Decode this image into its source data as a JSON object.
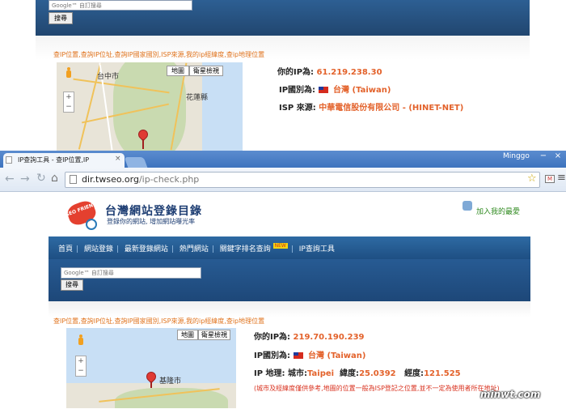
{
  "background_page": {
    "search_placeholder": "Google™ 自訂搜尋",
    "search_button": "搜尋",
    "links_line": "查IP位置,查詢IP位址,查詢IP國家國別,ISP來源,我的ip經緯度,查ip地理位置",
    "map": {
      "map_button": "地圖",
      "satellite_button": "衛星檢視",
      "zoom_in": "+",
      "zoom_out": "−",
      "labels": [
        "台中市",
        "花蓮縣"
      ]
    },
    "ip_label": "你的IP為:",
    "ip_value": "61.219.238.30",
    "country_label": "IP國別為:",
    "country_value": "台灣 (Taiwan)",
    "isp_label": "ISP 來源:",
    "isp_value": "中華電信股份有限公司 - (HINET-NET)"
  },
  "browser": {
    "tab_title": "IP查詢工具 - 查IP位置,IP",
    "tab_close": "×",
    "user": "Minggo",
    "window_buttons": [
      "−",
      "×"
    ],
    "url_host": "dir.twseo.org",
    "url_path": "/ip-check.php"
  },
  "site": {
    "logo_badge": "SEO FRIENDLY",
    "title": "台灣網站登錄目錄",
    "slogan": "登錄你的網站, 增加網站曝光率",
    "favorite_link": "加入我的最愛",
    "nav": [
      "首頁",
      "網站登錄",
      "最新登錄網站",
      "熱門網站",
      "關鍵字排名查詢",
      "IP查詢工具"
    ],
    "nav_badge": "NEW",
    "search_placeholder": "Google™ 自訂搜尋",
    "search_button": "搜尋",
    "links_line": "查IP位置,查詢IP位址,查詢IP國家國別,ISP來源,我的ip經緯度,查ip地理位置",
    "map": {
      "map_button": "地圖",
      "satellite_button": "衛星檢視",
      "zoom_in": "+",
      "zoom_out": "−",
      "labels": [
        "基隆市"
      ]
    },
    "ip_label": "你的IP為:",
    "ip_value": "219.70.190.239",
    "country_label": "IP國別為:",
    "country_value": "台灣 (Taiwan)",
    "geo_label": "IP 地理:",
    "city_label": "城市:",
    "city_value": "Taipei",
    "lat_label": "緯度:",
    "lat_value": "25.0392",
    "lng_label": "經度:",
    "lng_value": "121.525",
    "note": "(城市及經緯度僅供參考,地圖的位置一般為ISP登記之位置,並不一定為使用者所在地址)"
  },
  "watermark": "minwt.com",
  "colors": {
    "accent_orange": "#e3622b",
    "header_blue": "#21466f",
    "note_red": "#d9321f"
  }
}
